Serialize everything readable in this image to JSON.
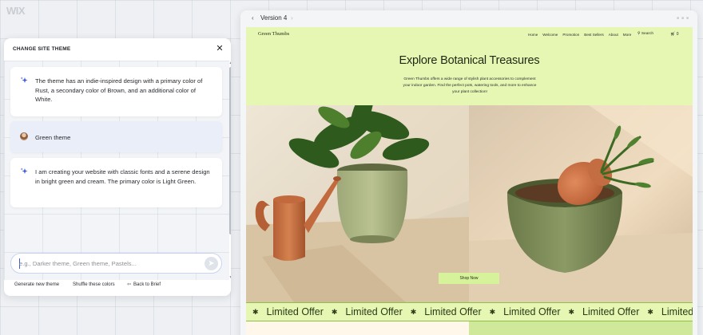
{
  "app": {
    "logo": "WIX"
  },
  "panel": {
    "title": "CHANGE SITE THEME",
    "messages": [
      {
        "role": "ai",
        "text": "The theme has an indie-inspired design with a primary color of Rust, a secondary color of Brown, and an additional color of White."
      },
      {
        "role": "user",
        "text": "Green theme"
      },
      {
        "role": "ai",
        "text": "I am creating your website with classic fonts and a serene design in bright green and cream. The primary color is Light Green."
      }
    ],
    "input": {
      "placeholder": "e.g., Darker theme, Green theme, Pastels...",
      "value": ""
    },
    "actions": {
      "generate": "Generate new theme",
      "shuffle": "Shuffle these colors",
      "back": "Back to Brief"
    }
  },
  "preview": {
    "version_label": "Version 4",
    "site": {
      "logo": "Green Thumbs",
      "nav": [
        "Home",
        "Welcome",
        "Promotion",
        "Best Sellers",
        "About",
        "More"
      ],
      "search_label": "Search",
      "cart_count": "0",
      "hero_title": "Explore Botanical Treasures",
      "hero_description": "Green Thumbs offers a wide range of stylish plant accessories to complement your indoor garden. Find the perfect pots, watering tools, and more to enhance your plant collection!",
      "cta": "Shop Now",
      "ticker_text": "Limited Offer"
    }
  },
  "colors": {
    "site_background": "#e6f7b3",
    "accent_button": "#d6f29a",
    "ticker_border": "#8fbf4d",
    "ai_sparkle": "#3b5bdb"
  }
}
